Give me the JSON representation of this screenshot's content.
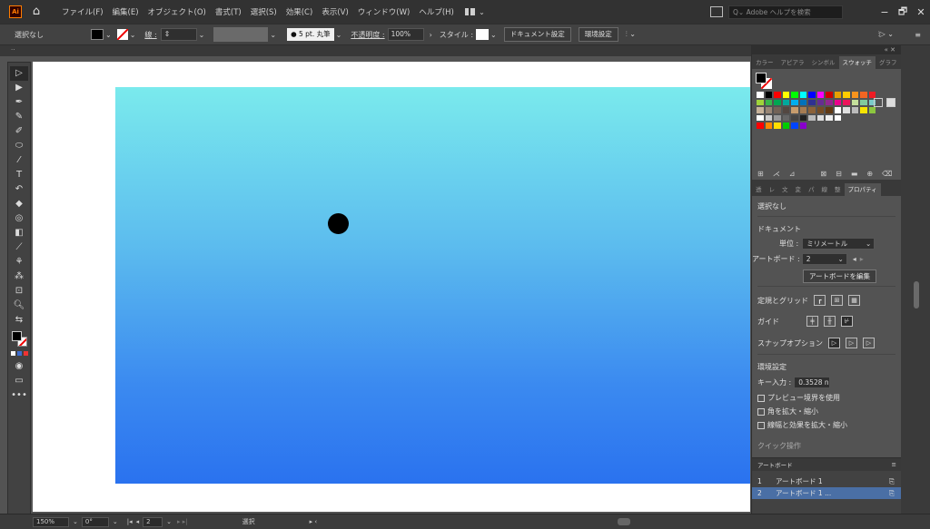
{
  "app": {
    "logo_text": "Ai",
    "menus": [
      "ファイル(F)",
      "編集(E)",
      "オブジェクト(O)",
      "書式(T)",
      "選択(S)",
      "効果(C)",
      "表示(V)",
      "ウィンドウ(W)",
      "ヘルプ(H)"
    ],
    "search_placeholder": "Adobe ヘルプを検索",
    "window_controls": [
      "−",
      "🗗",
      "✕"
    ]
  },
  "controlbar": {
    "selection": "選択なし",
    "stroke_label": "線 :",
    "brush": "● 5 pt. 丸筆",
    "opacity_label": "不透明度 :",
    "opacity_value": "100%",
    "style_label": "スタイル :",
    "doc_settings": "ドキュメント設定",
    "preferences": "環境設定",
    "colors": {
      "fill": "#000000",
      "stroke": "none"
    }
  },
  "canvas": {
    "gradient_top": "#7aeaed",
    "gradient_bottom": "#2a72ef",
    "dot_color": "#000000"
  },
  "panel": {
    "tabs": [
      "カラー",
      "アピアラ",
      "シンボル",
      "スウォッチ",
      "グラフ"
    ],
    "active_tab": "スウォッチ",
    "tabs2": [
      "透",
      "レ",
      "文",
      "変",
      "パ",
      "線",
      "整",
      "プロパティ"
    ],
    "properties": {
      "no_selection": "選択なし",
      "document": "ドキュメント",
      "units_label": "単位 :",
      "units_value": "ミリメートル",
      "artboard_label": "アートボード :",
      "artboard_value": "2",
      "edit_artboards": "アートボードを編集",
      "rulers_grids": "定規とグリッド",
      "guides": "ガイド",
      "snap_options": "スナップオプション",
      "preferences": "環境設定",
      "key_input_label": "キー入力 :",
      "key_input_value": "0.3528 n",
      "preview_bounds": "プレビュー境界を使用",
      "scale_corners": "角を拡大・縮小",
      "scale_strokes": "線幅と効果を拡大・縮小",
      "quick_actions": "クイック操作"
    }
  },
  "artboards_panel": {
    "title": "アートボード",
    "items": [
      {
        "num": "1",
        "name": "アートボード 1"
      },
      {
        "num": "2",
        "name": "アートボード 1 ..."
      }
    ]
  },
  "statusbar": {
    "zoom": "150%",
    "rotation": "0°",
    "artboard_nav": "2",
    "tool": "選択"
  }
}
